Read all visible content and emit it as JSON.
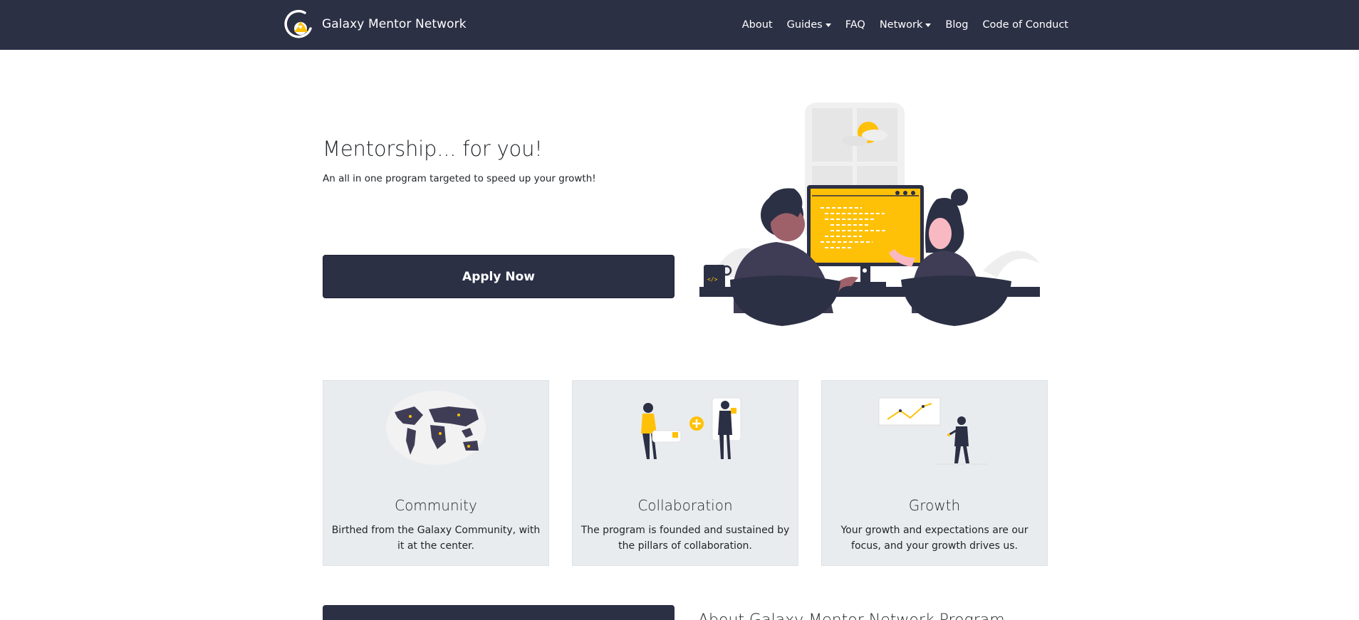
{
  "brand": {
    "name": "Galaxy Mentor Network",
    "logo_icon": "galaxy-logo-icon"
  },
  "nav": {
    "about": "About",
    "guides": "Guides",
    "faq": "FAQ",
    "network": "Network",
    "blog": "Blog",
    "code_of_conduct": "Code of Conduct"
  },
  "hero": {
    "title": "Mentorship... for you!",
    "subtitle": "An all in one program targeted to speed up your growth!",
    "apply_label": "Apply Now",
    "illustration": "pair-programming-illustration"
  },
  "cards": [
    {
      "title": "Community",
      "text": "Birthed from the Galaxy Community, with it at the center.",
      "illustration": "world-map-illustration"
    },
    {
      "title": "Collaboration",
      "text": "The program is founded and sustained by the pillars of collaboration.",
      "illustration": "collaboration-illustration"
    },
    {
      "title": "Growth",
      "text": "Your growth and expectations are our focus, and your growth drives us.",
      "illustration": "growth-chart-illustration"
    }
  ],
  "about": {
    "heading": "About Galaxy Mentor Network Program"
  },
  "colors": {
    "navbar": "#2c3045",
    "accent": "#ffc107",
    "card_bg": "#e9ecef"
  }
}
